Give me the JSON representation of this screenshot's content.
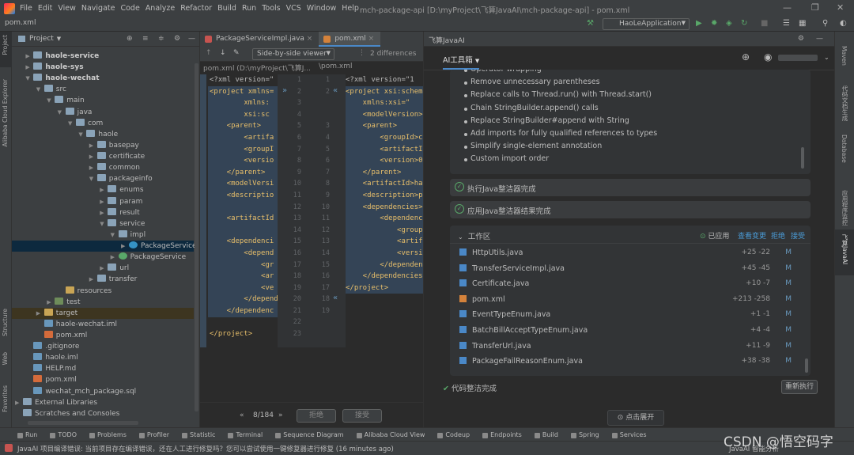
{
  "app": {
    "window_title": "mch-package-api [D:\\myProject\\飞算JavaAI\\mch-package-api] - pom.xml",
    "menu": [
      "File",
      "Edit",
      "View",
      "Navigate",
      "Code",
      "Analyze",
      "Refactor",
      "Build",
      "Run",
      "Tools",
      "VCS",
      "Window",
      "Help"
    ]
  },
  "navbar": {
    "breadcrumb": "pom.xml",
    "run_config": "HaoLeApplication"
  },
  "left_strip": {
    "labels": [
      "Project",
      "Alibaba Cloud Explorer",
      "Structure",
      "Web",
      "Favorites"
    ]
  },
  "project": {
    "title": "Project",
    "tree": [
      {
        "label": "haole-service",
        "depth": 1,
        "icon": "folder",
        "bold": true,
        "arrow": "▶"
      },
      {
        "label": "haole-sys",
        "depth": 1,
        "icon": "folder",
        "bold": true,
        "arrow": "▶"
      },
      {
        "label": "haole-wechat",
        "depth": 1,
        "icon": "folder",
        "bold": true,
        "arrow": "▼"
      },
      {
        "label": "src",
        "depth": 2,
        "icon": "folder",
        "arrow": "▼"
      },
      {
        "label": "main",
        "depth": 3,
        "icon": "folder",
        "arrow": "▼"
      },
      {
        "label": "java",
        "depth": 4,
        "icon": "folder",
        "arrow": "▼"
      },
      {
        "label": "com",
        "depth": 5,
        "icon": "folder",
        "arrow": "▼"
      },
      {
        "label": "haole",
        "depth": 6,
        "icon": "folder",
        "arrow": "▼"
      },
      {
        "label": "basepay",
        "depth": 7,
        "icon": "folder",
        "arrow": "▶"
      },
      {
        "label": "certificate",
        "depth": 7,
        "icon": "folder",
        "arrow": "▶"
      },
      {
        "label": "common",
        "depth": 7,
        "icon": "folder",
        "arrow": "▶"
      },
      {
        "label": "packageinfo",
        "depth": 7,
        "icon": "folder",
        "arrow": "▼"
      },
      {
        "label": "enums",
        "depth": 8,
        "icon": "folder",
        "arrow": "▶"
      },
      {
        "label": "param",
        "depth": 8,
        "icon": "folder",
        "arrow": "▶"
      },
      {
        "label": "result",
        "depth": 8,
        "icon": "folder",
        "arrow": "▶"
      },
      {
        "label": "service",
        "depth": 8,
        "icon": "folder",
        "arrow": "▼"
      },
      {
        "label": "impl",
        "depth": 9,
        "icon": "folder",
        "arrow": "▼"
      },
      {
        "label": "PackageServiceImpl",
        "depth": 10,
        "icon": "class",
        "arrow": "▶",
        "selected": true
      },
      {
        "label": "PackageService",
        "depth": 9,
        "icon": "interface",
        "arrow": "▶"
      },
      {
        "label": "url",
        "depth": 8,
        "icon": "folder",
        "arrow": "▶"
      },
      {
        "label": "transfer",
        "depth": 7,
        "icon": "folder",
        "arrow": "▶"
      },
      {
        "label": "resources",
        "depth": 4,
        "icon": "folder-y",
        "arrow": ""
      },
      {
        "label": "test",
        "depth": 3,
        "icon": "folder-g",
        "arrow": "▶"
      },
      {
        "label": "target",
        "depth": 2,
        "icon": "folder-y",
        "arrow": "▶",
        "target": true
      },
      {
        "label": "haole-wechat.iml",
        "depth": 2,
        "icon": "file-i",
        "arrow": ""
      },
      {
        "label": "pom.xml",
        "depth": 2,
        "icon": "file-x",
        "arrow": ""
      },
      {
        "label": ".gitignore",
        "depth": 1,
        "icon": "file-i",
        "arrow": ""
      },
      {
        "label": "haole.iml",
        "depth": 1,
        "icon": "file-i",
        "arrow": ""
      },
      {
        "label": "HELP.md",
        "depth": 1,
        "icon": "file-i",
        "arrow": ""
      },
      {
        "label": "pom.xml",
        "depth": 1,
        "icon": "file-x",
        "arrow": ""
      },
      {
        "label": "wechat_mch_package.sql",
        "depth": 1,
        "icon": "file-i",
        "arrow": ""
      },
      {
        "label": "External Libraries",
        "depth": 0,
        "icon": "folder",
        "arrow": "▶"
      },
      {
        "label": "Scratches and Consoles",
        "depth": 0,
        "icon": "folder",
        "arrow": ""
      }
    ]
  },
  "editor": {
    "tabs": [
      "PackageServiceImpl.java",
      "pom.xml"
    ],
    "diff_mode": "Side-by-side viewer",
    "diff_count": "2 differences",
    "left_path": "pom.xml (D:\\myProject\\飞算J...",
    "right_path": "\\pom.xml",
    "left_code": [
      "<?xml version=\"",
      "<project xmlns=",
      "        xmlns:",
      "        xsi:sc",
      "    <parent>",
      "        <artifa",
      "        <groupI",
      "        <versio",
      "    </parent>",
      "    <modelVersi",
      "    <descriptio",
      "",
      "    <artifactId",
      "",
      "    <dependenci",
      "        <depend",
      "            <gr",
      "            <ar",
      "            <ve",
      "        </depend",
      "    </dependenc",
      "",
      "</project>"
    ],
    "mid_left_nums": [
      "1",
      "2",
      "3",
      "4",
      "5",
      "6",
      "7",
      "8",
      "9",
      "10",
      "11",
      "12",
      "13",
      "14",
      "15",
      "16",
      "17",
      "18",
      "19",
      "20",
      "21",
      "22",
      "23"
    ],
    "mid_right_nums": [
      "1",
      "2",
      "",
      "",
      "3",
      "4",
      "5",
      "6",
      "7",
      "8",
      "9",
      "10",
      "11",
      "12",
      "13",
      "14",
      "15",
      "16",
      "17",
      "18",
      "19",
      "",
      ""
    ],
    "right_code": [
      "<?xml version=\"1",
      "<project xsi:schem",
      "    xmlns:xsi=\"",
      "    <modelVersion>",
      "    <parent>",
      "        <groupId>com",
      "        <artifactId>",
      "        <version>0.0",
      "    </parent>",
      "    <artifactId>ha",
      "    <description>p",
      "    <dependencies>",
      "        <dependency>",
      "            <groupId>c",
      "            <artifactI",
      "            <version>2",
      "        </dependency",
      "    </dependencies",
      "</project>"
    ],
    "nav_counter": "8/184",
    "reject_label": "拒绝",
    "accept_label": "接受"
  },
  "ai": {
    "panel_title": "飞算JavaAI",
    "tool_tab": "AI工具箱",
    "bullets": [
      "Operator wrapping",
      "Remove unnecessary parentheses",
      "Replace calls to Thread.run() with Thread.start()",
      "Chain StringBuilder.append() calls",
      "Replace StringBuilder#append with String",
      "Add imports for fully qualified references to types",
      "Simplify single-element annotation",
      "Custom import order"
    ],
    "status1": "执行Java整洁器完成",
    "status2": "应用Java整洁器结果完成",
    "workspace": {
      "title": "工作区",
      "applied": "已应用",
      "view_changes": "查看变更",
      "reject": "拒绝",
      "accept": "接受",
      "files": [
        {
          "name": "HttpUtils.java",
          "delta": "+25 -22",
          "mark": "M",
          "type": "java"
        },
        {
          "name": "TransferServiceImpl.java",
          "delta": "+45 -45",
          "mark": "M",
          "type": "java"
        },
        {
          "name": "Certificate.java",
          "delta": "+10 -7",
          "mark": "M",
          "type": "java"
        },
        {
          "name": "pom.xml",
          "delta": "+213 -258",
          "mark": "M",
          "type": "xml"
        },
        {
          "name": "EventTypeEnum.java",
          "delta": "+1 -1",
          "mark": "M",
          "type": "java"
        },
        {
          "name": "BatchBillAcceptTypeEnum.java",
          "delta": "+4 -4",
          "mark": "M",
          "type": "java"
        },
        {
          "name": "TransferUrl.java",
          "delta": "+11 -9",
          "mark": "M",
          "type": "java"
        },
        {
          "name": "PackageFailReasonEnum.java",
          "delta": "+38 -38",
          "mark": "M",
          "type": "java"
        }
      ]
    },
    "done_label": "代码整洁完成",
    "rerun_label": "重新执行",
    "expand_label": "点击展开"
  },
  "right_strip": {
    "labels": [
      "Maven",
      "代码文档生成",
      "Database",
      "应用程序监控",
      "飞算JavaAI"
    ]
  },
  "bottom_tools": [
    "Run",
    "TODO",
    "Problems",
    "Profiler",
    "Statistic",
    "Terminal",
    "Sequence Diagram",
    "Alibaba Cloud View",
    "Codeup",
    "Endpoints",
    "Build",
    "Spring",
    "Services"
  ],
  "status": {
    "message": "JavaAI 项目编译错误: 当前项目存在编译错误，还在人工进行修复吗？您可以尝试使用一键修复器进行修复 (16 minutes ago)",
    "right_text": "JavaAI 智能分析"
  },
  "watermark": "CSDN @悟空码字",
  "colors": {
    "accent": "#4a88c7",
    "success": "#59a869"
  }
}
